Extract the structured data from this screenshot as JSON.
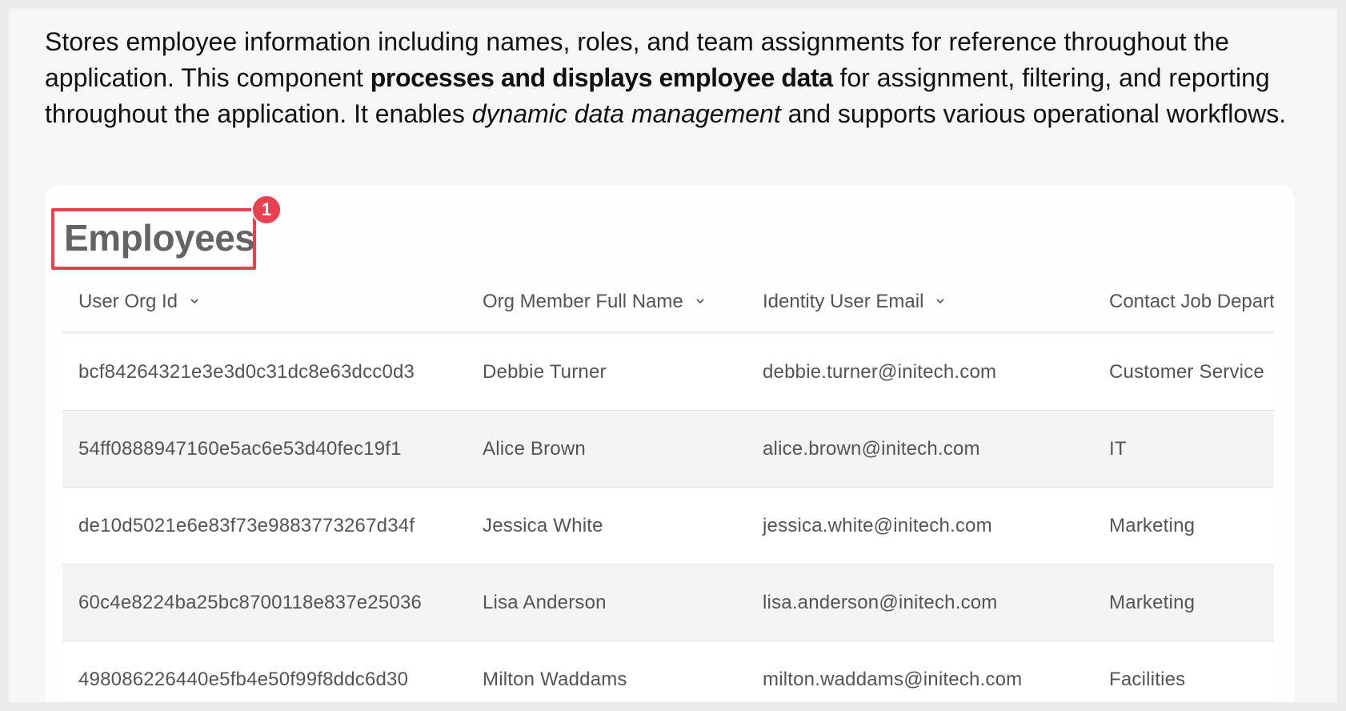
{
  "description": {
    "part1": "Stores employee information including names, roles, and team assignments for reference throughout the application. This component ",
    "bold": "processes and displays employee data",
    "part2": " for assignment, filtering, and reporting throughout the application. It enables ",
    "italic": "dynamic data management",
    "part3": " and supports various operational workflows."
  },
  "card": {
    "title": "Employees",
    "badge": "1"
  },
  "table": {
    "columns": [
      {
        "label": "User Org Id",
        "icon": "chevron-down-icon"
      },
      {
        "label": "Org Member Full Name",
        "icon": "chevron-down-icon"
      },
      {
        "label": "Identity User Email",
        "icon": "chevron-down-icon"
      },
      {
        "label": "Contact Job Department"
      }
    ],
    "rows": [
      {
        "id": "bcf84264321e3e3d0c31dc8e63dcc0d3",
        "name": "Debbie Turner",
        "email": "debbie.turner@initech.com",
        "dept": "Customer Service"
      },
      {
        "id": "54ff0888947160e5ac6e53d40fec19f1",
        "name": "Alice Brown",
        "email": "alice.brown@initech.com",
        "dept": "IT"
      },
      {
        "id": "de10d5021e6e83f73e9883773267d34f",
        "name": "Jessica White",
        "email": "jessica.white@initech.com",
        "dept": "Marketing"
      },
      {
        "id": "60c4e8224ba25bc8700118e837e25036",
        "name": "Lisa Anderson",
        "email": "lisa.anderson@initech.com",
        "dept": "Marketing"
      },
      {
        "id": "498086226440e5fb4e50f99f8ddc6d30",
        "name": "Milton Waddams",
        "email": "milton.waddams@initech.com",
        "dept": "Facilities"
      }
    ]
  },
  "colors": {
    "accent": "#e8404f",
    "title": "#646464",
    "text": "#545454"
  }
}
